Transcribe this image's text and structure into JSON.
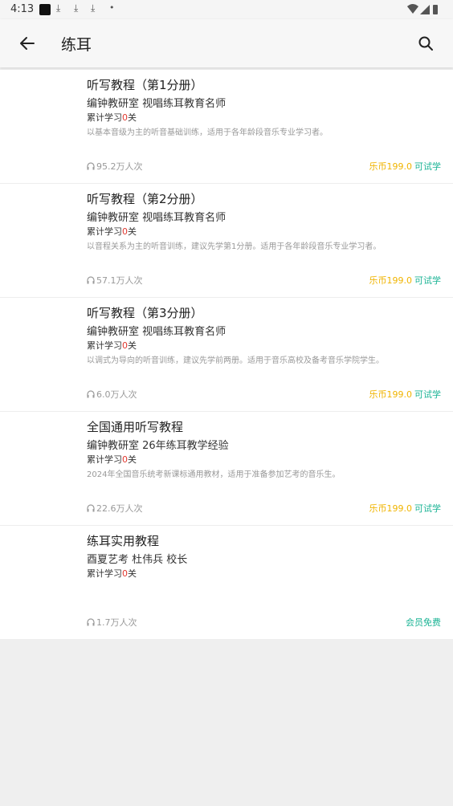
{
  "status": {
    "time": "4:13",
    "download_icon": "⤓",
    "dot": "•"
  },
  "appbar": {
    "title": "练耳",
    "back_icon": "arrow-left",
    "search_icon": "search"
  },
  "courses": [
    {
      "title": "听写教程（第1分册）",
      "author": "编钟教研室  视唱练耳教育名师",
      "progress_pre": "累计学习",
      "progress_num": "0",
      "progress_post": "关",
      "desc": "以基本音级为主的听音基础训练，适用于各年龄段音乐专业学习者。",
      "views": "95.2万人次",
      "price": "乐币199.0",
      "tag": "可试学"
    },
    {
      "title": "听写教程（第2分册）",
      "author": "编钟教研室  视唱练耳教育名师",
      "progress_pre": "累计学习",
      "progress_num": "0",
      "progress_post": "关",
      "desc": "以音程关系为主的听音训练，建议先学第1分册。适用于各年龄段音乐专业学习者。",
      "views": "57.1万人次",
      "price": "乐币199.0",
      "tag": "可试学"
    },
    {
      "title": "听写教程（第3分册）",
      "author": "编钟教研室  视唱练耳教育名师",
      "progress_pre": "累计学习",
      "progress_num": "0",
      "progress_post": "关",
      "desc": "以调式为导向的听音训练，建议先学前两册。适用于音乐高校及备考音乐学院学生。",
      "views": "6.0万人次",
      "price": "乐币199.0",
      "tag": "可试学"
    },
    {
      "title": "全国通用听写教程",
      "author": "编钟教研室  26年练耳教学经验",
      "progress_pre": "累计学习",
      "progress_num": "0",
      "progress_post": "关",
      "desc": "2024年全国音乐统考新课标通用教材，适用于准备参加艺考的音乐生。",
      "views": "22.6万人次",
      "price": "乐币199.0",
      "tag": "可试学"
    },
    {
      "title": "练耳实用教程",
      "author": "酉夏艺考  杜伟兵 校长",
      "progress_pre": "累计学习",
      "progress_num": "0",
      "progress_post": "关",
      "desc": "",
      "views": "1.7万人次",
      "price": "",
      "tag": "会员免费"
    }
  ],
  "colors": {
    "price": "#f0b400",
    "tag": "#1ab394",
    "count": "#e0382f"
  }
}
